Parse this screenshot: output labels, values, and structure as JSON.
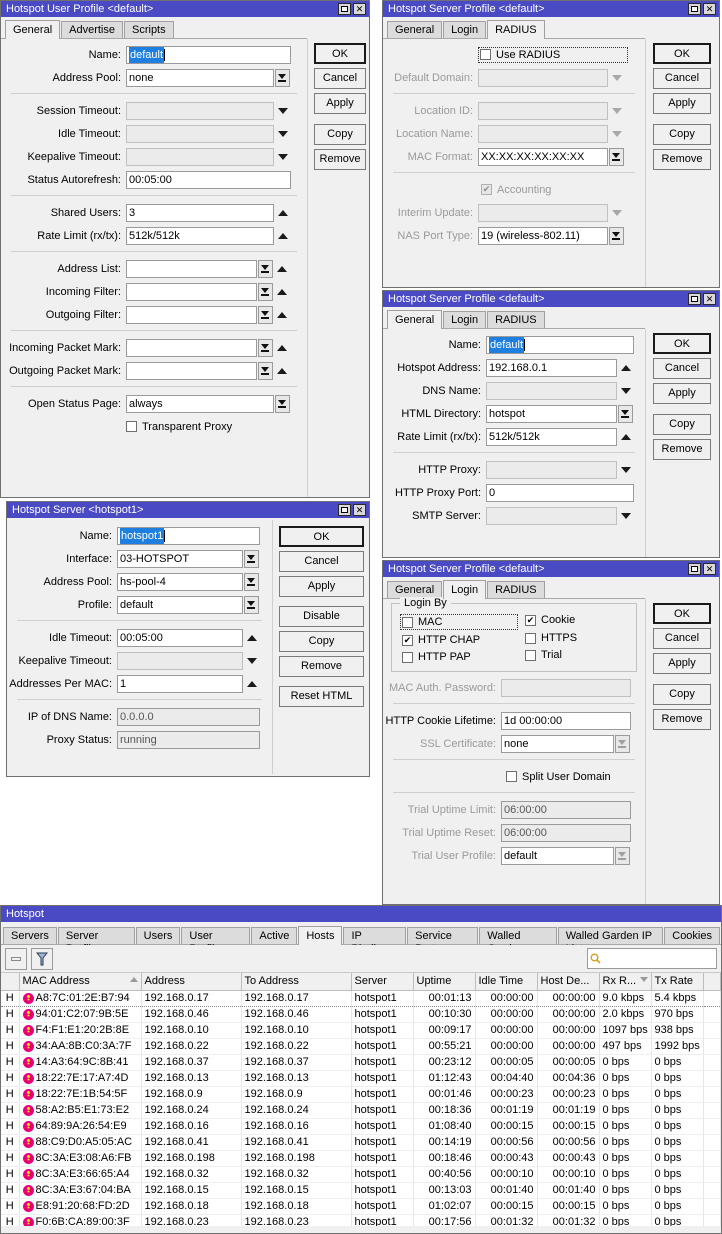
{
  "colors": {
    "titlebar": "#4a4ac4",
    "selection": "#1e7fe0",
    "window_bg": "#f0f0f0",
    "mac_icon": "#e6007e"
  },
  "user_profile_window": {
    "title": "Hotspot User Profile <default>",
    "tabs": [
      {
        "label": "General",
        "active": true
      },
      {
        "label": "Advertise",
        "active": false
      },
      {
        "label": "Scripts",
        "active": false
      }
    ],
    "fields": [
      {
        "label": "Name:",
        "value": "default",
        "selected": true
      },
      {
        "label": "Address Pool:",
        "value": "none"
      },
      {
        "label": "Session Timeout:",
        "value": ""
      },
      {
        "label": "Idle Timeout:",
        "value": ""
      },
      {
        "label": "Keepalive Timeout:",
        "value": ""
      },
      {
        "label": "Status Autorefresh:",
        "value": "00:05:00"
      },
      {
        "label": "Shared Users:",
        "value": "3"
      },
      {
        "label": "Rate Limit (rx/tx):",
        "value": "512k/512k"
      },
      {
        "label": "Address List:",
        "value": ""
      },
      {
        "label": "Incoming Filter:",
        "value": ""
      },
      {
        "label": "Outgoing Filter:",
        "value": ""
      },
      {
        "label": "Incoming Packet Mark:",
        "value": ""
      },
      {
        "label": "Outgoing Packet Mark:",
        "value": ""
      },
      {
        "label": "Open Status Page:",
        "value": "always"
      }
    ],
    "transparent_proxy_label": "Transparent Proxy",
    "buttons": [
      "OK",
      "Cancel",
      "Apply",
      "Copy",
      "Remove"
    ]
  },
  "radius_window": {
    "title": "Hotspot Server Profile <default>",
    "tabs": [
      {
        "label": "General",
        "active": false
      },
      {
        "label": "Login",
        "active": false
      },
      {
        "label": "RADIUS",
        "active": true
      }
    ],
    "use_radius_label": "Use RADIUS",
    "use_radius_checked": false,
    "fields": [
      {
        "label": "Default Domain:",
        "value": "",
        "disabled": true
      },
      {
        "label": "Location ID:",
        "value": "",
        "disabled": true
      },
      {
        "label": "Location Name:",
        "value": "",
        "disabled": true
      },
      {
        "label": "MAC Format:",
        "value": "XX:XX:XX:XX:XX:XX",
        "disabled": false
      },
      {
        "label": "Interim Update:",
        "value": "",
        "disabled": true
      },
      {
        "label": "NAS Port Type:",
        "value": "19 (wireless-802.11)",
        "disabled": false
      }
    ],
    "accounting_label": "Accounting",
    "accounting_checked": true,
    "buttons": [
      "OK",
      "Cancel",
      "Apply",
      "Copy",
      "Remove"
    ]
  },
  "general_window": {
    "title": "Hotspot Server Profile <default>",
    "tabs": [
      {
        "label": "General",
        "active": true
      },
      {
        "label": "Login",
        "active": false
      },
      {
        "label": "RADIUS",
        "active": false
      }
    ],
    "fields": [
      {
        "label": "Name:",
        "value": "default",
        "selected": true
      },
      {
        "label": "Hotspot Address:",
        "value": "192.168.0.1"
      },
      {
        "label": "DNS Name:",
        "value": ""
      },
      {
        "label": "HTML Directory:",
        "value": "hotspot"
      },
      {
        "label": "Rate Limit (rx/tx):",
        "value": "512k/512k"
      },
      {
        "label": "HTTP Proxy:",
        "value": ""
      },
      {
        "label": "HTTP Proxy Port:",
        "value": "0"
      },
      {
        "label": "SMTP Server:",
        "value": ""
      }
    ],
    "buttons": [
      "OK",
      "Cancel",
      "Apply",
      "Copy",
      "Remove"
    ]
  },
  "server_window": {
    "title": "Hotspot Server <hotspot1>",
    "fields": [
      {
        "label": "Name:",
        "value": "hotspot1",
        "selected": true
      },
      {
        "label": "Interface:",
        "value": "03-HOTSPOT"
      },
      {
        "label": "Address Pool:",
        "value": "hs-pool-4"
      },
      {
        "label": "Profile:",
        "value": "default"
      },
      {
        "label": "Idle Timeout:",
        "value": "00:05:00"
      },
      {
        "label": "Keepalive Timeout:",
        "value": ""
      },
      {
        "label": "Addresses Per MAC:",
        "value": "1"
      },
      {
        "label": "IP of DNS Name:",
        "value": "0.0.0.0"
      },
      {
        "label": "Proxy Status:",
        "value": "running"
      }
    ],
    "buttons": [
      "OK",
      "Cancel",
      "Apply",
      "Disable",
      "Copy",
      "Remove",
      "Reset HTML"
    ]
  },
  "login_window": {
    "title": "Hotspot Server Profile <default>",
    "tabs": [
      {
        "label": "General",
        "active": false
      },
      {
        "label": "Login",
        "active": true
      },
      {
        "label": "RADIUS",
        "active": false
      }
    ],
    "group_title": "Login By",
    "checkboxes": [
      {
        "label": "MAC",
        "checked": false,
        "focused": true
      },
      {
        "label": "Cookie",
        "checked": true
      },
      {
        "label": "HTTP CHAP",
        "checked": true
      },
      {
        "label": "HTTPS",
        "checked": false
      },
      {
        "label": "HTTP PAP",
        "checked": false
      },
      {
        "label": "Trial",
        "checked": false
      }
    ],
    "fields": [
      {
        "label": "MAC Auth. Password:",
        "value": "",
        "disabled": true
      },
      {
        "label": "HTTP Cookie Lifetime:",
        "value": "1d 00:00:00",
        "disabled": false
      },
      {
        "label": "SSL Certificate:",
        "value": "none",
        "disabled": true
      },
      {
        "label": "Trial Uptime Limit:",
        "value": "06:00:00",
        "disabled": true
      },
      {
        "label": "Trial Uptime Reset:",
        "value": "06:00:00",
        "disabled": true
      },
      {
        "label": "Trial User Profile:",
        "value": "default",
        "disabled": true
      }
    ],
    "split_user_domain_label": "Split User Domain",
    "split_user_domain_checked": false,
    "buttons": [
      "OK",
      "Cancel",
      "Apply",
      "Copy",
      "Remove"
    ]
  },
  "hotspot_window": {
    "title": "Hotspot",
    "tabs": [
      {
        "label": "Servers",
        "active": false
      },
      {
        "label": "Server Profiles",
        "active": false
      },
      {
        "label": "Users",
        "active": false
      },
      {
        "label": "User Profiles",
        "active": false
      },
      {
        "label": "Active",
        "active": false
      },
      {
        "label": "Hosts",
        "active": true
      },
      {
        "label": "IP Bindings",
        "active": false
      },
      {
        "label": "Service Ports",
        "active": false
      },
      {
        "label": "Walled Garden",
        "active": false
      },
      {
        "label": "Walled Garden IP List",
        "active": false
      },
      {
        "label": "Cookies",
        "active": false
      }
    ],
    "toolbar": {
      "remove_icon": "minus-icon",
      "filter_icon": "funnel-icon",
      "search_placeholder": ""
    },
    "columns": [
      "",
      "MAC Address",
      "Address",
      "To Address",
      "Server",
      "Uptime",
      "Idle Time",
      "Host De...",
      "Rx R...",
      "Tx Rate",
      ""
    ],
    "sorted_columns": [
      "MAC Address",
      "Rx R..."
    ],
    "rows": [
      {
        "flag": "H",
        "mac": "A8:7C:01:2E:B7:94",
        "address": "192.168.0.17",
        "to_address": "192.168.0.17",
        "server": "hotspot1",
        "uptime": "00:01:13",
        "idle": "00:00:00",
        "host_de": "00:00:00",
        "rx": "9.0 kbps",
        "tx": "5.4 kbps"
      },
      {
        "flag": "H",
        "mac": "94:01:C2:07:9B:5E",
        "address": "192.168.0.46",
        "to_address": "192.168.0.46",
        "server": "hotspot1",
        "uptime": "00:10:30",
        "idle": "00:00:00",
        "host_de": "00:00:00",
        "rx": "2.0 kbps",
        "tx": "970 bps"
      },
      {
        "flag": "H",
        "mac": "F4:F1:E1:20:2B:8E",
        "address": "192.168.0.10",
        "to_address": "192.168.0.10",
        "server": "hotspot1",
        "uptime": "00:09:17",
        "idle": "00:00:00",
        "host_de": "00:00:00",
        "rx": "1097 bps",
        "tx": "938 bps"
      },
      {
        "flag": "H",
        "mac": "34:AA:8B:C0:3A:7F",
        "address": "192.168.0.22",
        "to_address": "192.168.0.22",
        "server": "hotspot1",
        "uptime": "00:55:21",
        "idle": "00:00:00",
        "host_de": "00:00:00",
        "rx": "497 bps",
        "tx": "1992 bps"
      },
      {
        "flag": "H",
        "mac": "14:A3:64:9C:8B:41",
        "address": "192.168.0.37",
        "to_address": "192.168.0.37",
        "server": "hotspot1",
        "uptime": "00:23:12",
        "idle": "00:00:05",
        "host_de": "00:00:05",
        "rx": "0 bps",
        "tx": "0 bps"
      },
      {
        "flag": "H",
        "mac": "18:22:7E:17:A7:4D",
        "address": "192.168.0.13",
        "to_address": "192.168.0.13",
        "server": "hotspot1",
        "uptime": "01:12:43",
        "idle": "00:04:40",
        "host_de": "00:04:36",
        "rx": "0 bps",
        "tx": "0 bps"
      },
      {
        "flag": "H",
        "mac": "18:22:7E:1B:54:5F",
        "address": "192.168.0.9",
        "to_address": "192.168.0.9",
        "server": "hotspot1",
        "uptime": "00:01:46",
        "idle": "00:00:23",
        "host_de": "00:00:23",
        "rx": "0 bps",
        "tx": "0 bps"
      },
      {
        "flag": "H",
        "mac": "58:A2:B5:E1:73:E2",
        "address": "192.168.0.24",
        "to_address": "192.168.0.24",
        "server": "hotspot1",
        "uptime": "00:18:36",
        "idle": "00:01:19",
        "host_de": "00:01:19",
        "rx": "0 bps",
        "tx": "0 bps"
      },
      {
        "flag": "H",
        "mac": "64:89:9A:26:54:E9",
        "address": "192.168.0.16",
        "to_address": "192.168.0.16",
        "server": "hotspot1",
        "uptime": "01:08:40",
        "idle": "00:00:15",
        "host_de": "00:00:15",
        "rx": "0 bps",
        "tx": "0 bps"
      },
      {
        "flag": "H",
        "mac": "88:C9:D0:A5:05:AC",
        "address": "192.168.0.41",
        "to_address": "192.168.0.41",
        "server": "hotspot1",
        "uptime": "00:14:19",
        "idle": "00:00:56",
        "host_de": "00:00:56",
        "rx": "0 bps",
        "tx": "0 bps"
      },
      {
        "flag": "H",
        "mac": "8C:3A:E3:08:A6:FB",
        "address": "192.168.0.198",
        "to_address": "192.168.0.198",
        "server": "hotspot1",
        "uptime": "00:18:46",
        "idle": "00:00:43",
        "host_de": "00:00:43",
        "rx": "0 bps",
        "tx": "0 bps"
      },
      {
        "flag": "H",
        "mac": "8C:3A:E3:66:65:A4",
        "address": "192.168.0.32",
        "to_address": "192.168.0.32",
        "server": "hotspot1",
        "uptime": "00:40:56",
        "idle": "00:00:10",
        "host_de": "00:00:10",
        "rx": "0 bps",
        "tx": "0 bps"
      },
      {
        "flag": "H",
        "mac": "8C:3A:E3:67:04:BA",
        "address": "192.168.0.15",
        "to_address": "192.168.0.15",
        "server": "hotspot1",
        "uptime": "00:13:03",
        "idle": "00:01:40",
        "host_de": "00:01:40",
        "rx": "0 bps",
        "tx": "0 bps"
      },
      {
        "flag": "H",
        "mac": "E8:91:20:68:FD:2D",
        "address": "192.168.0.18",
        "to_address": "192.168.0.18",
        "server": "hotspot1",
        "uptime": "01:02:07",
        "idle": "00:00:15",
        "host_de": "00:00:15",
        "rx": "0 bps",
        "tx": "0 bps"
      },
      {
        "flag": "H",
        "mac": "F0:6B:CA:89:00:3F",
        "address": "192.168.0.23",
        "to_address": "192.168.0.23",
        "server": "hotspot1",
        "uptime": "00:17:56",
        "idle": "00:01:32",
        "host_de": "00:01:32",
        "rx": "0 bps",
        "tx": "0 bps"
      }
    ]
  }
}
